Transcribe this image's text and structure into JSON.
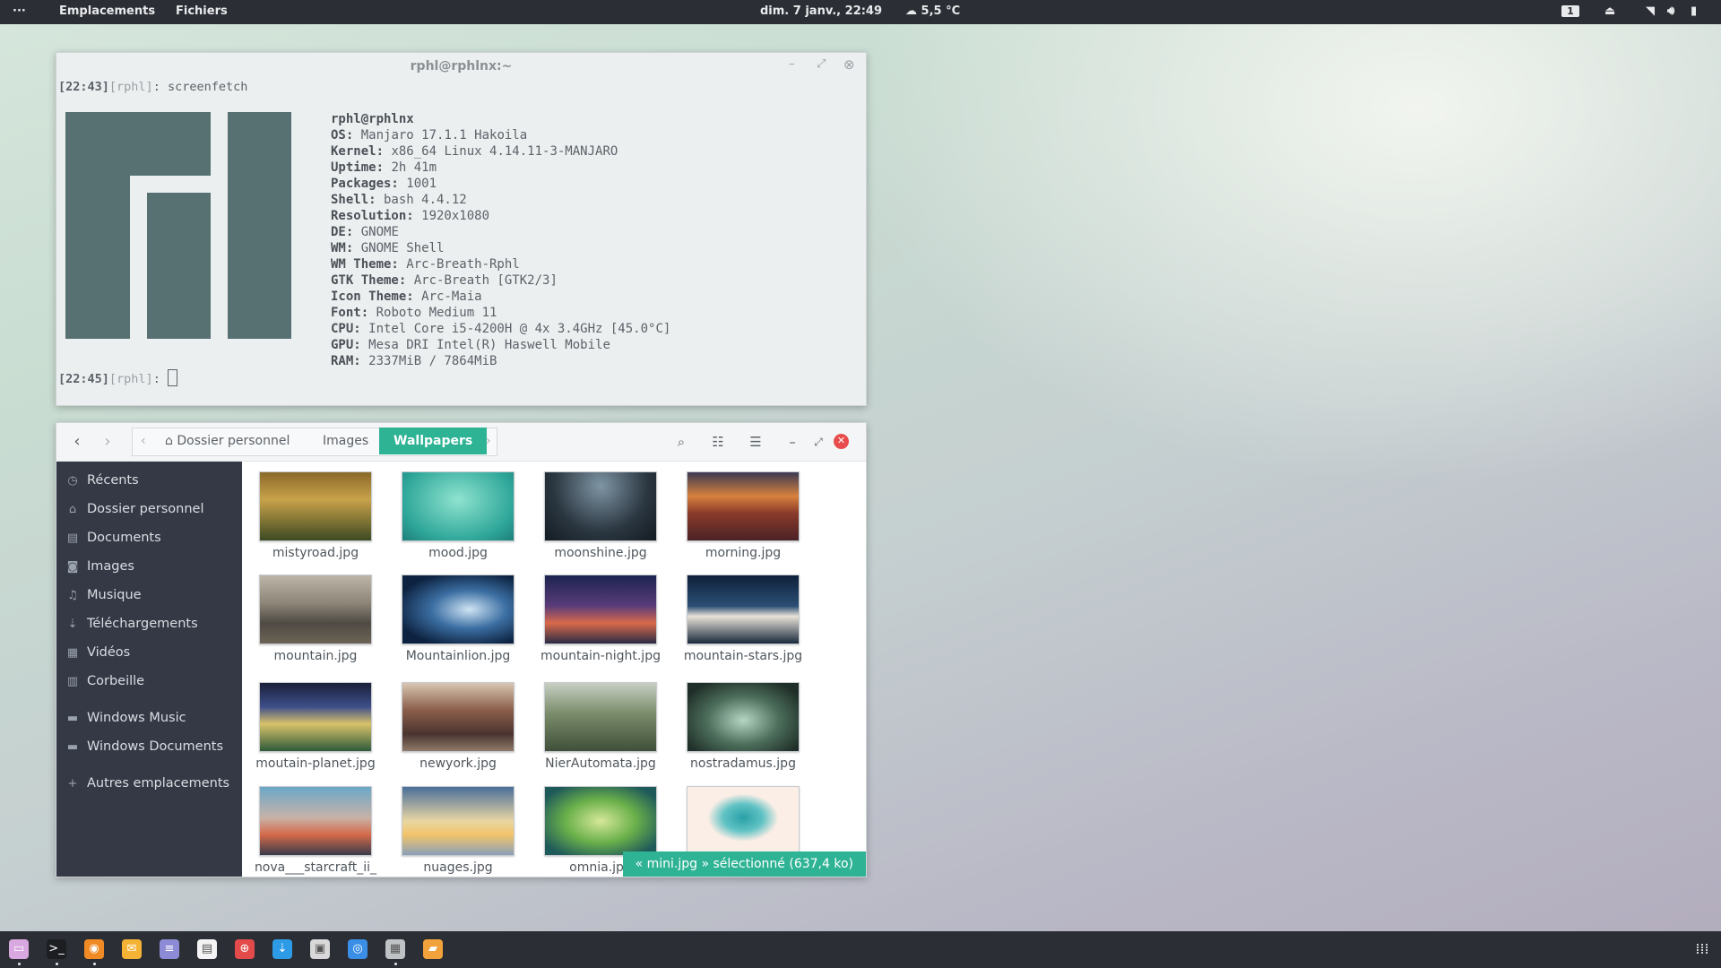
{
  "topbar": {
    "dots": "···",
    "places": "Emplacements",
    "files": "Fichiers",
    "datetime": "dim. 7 janv., 22:49",
    "weather": "☁ 5,5 °C",
    "workspace": "1"
  },
  "terminal": {
    "title": "rphl@rphlnx:~",
    "prompt1_time": "[22:43]",
    "prompt1_user": "[rphl]",
    "prompt1_cmd": ": screenfetch",
    "prompt2_time": "[22:45]",
    "prompt2_user": "[rphl]",
    "prompt2_rest": ": ",
    "user_host": "rphl@rphlnx",
    "info": [
      {
        "k": "OS:",
        "v": " Manjaro 17.1.1 Hakoila"
      },
      {
        "k": "Kernel:",
        "v": " x86_64 Linux 4.14.11-3-MANJARO"
      },
      {
        "k": "Uptime:",
        "v": " 2h 41m"
      },
      {
        "k": "Packages:",
        "v": " 1001"
      },
      {
        "k": "Shell:",
        "v": " bash 4.4.12"
      },
      {
        "k": "Resolution:",
        "v": " 1920x1080"
      },
      {
        "k": "DE:",
        "v": " GNOME"
      },
      {
        "k": "WM:",
        "v": " GNOME Shell"
      },
      {
        "k": "WM Theme:",
        "v": " Arc-Breath-Rphl"
      },
      {
        "k": "GTK Theme:",
        "v": " Arc-Breath [GTK2/3]"
      },
      {
        "k": "Icon Theme:",
        "v": " Arc-Maia"
      },
      {
        "k": "Font:",
        "v": " Roboto Medium 11"
      },
      {
        "k": "CPU:",
        "v": " Intel Core i5-4200H @ 4x 3.4GHz [45.0°C]"
      },
      {
        "k": "GPU:",
        "v": " Mesa DRI Intel(R) Haswell Mobile"
      },
      {
        "k": "RAM:",
        "v": " 2337MiB / 7864MiB"
      }
    ]
  },
  "files": {
    "crumbs": {
      "home": "Dossier personnel",
      "images": "Images",
      "wallpapers": "Wallpapers"
    },
    "sidebar": [
      {
        "icon": "clock-icon",
        "glyph": "◷",
        "label": "Récents"
      },
      {
        "icon": "home-icon",
        "glyph": "⌂",
        "label": "Dossier personnel"
      },
      {
        "icon": "document-icon",
        "glyph": "▤",
        "label": "Documents"
      },
      {
        "icon": "camera-icon",
        "glyph": "◙",
        "label": "Images"
      },
      {
        "icon": "music-icon",
        "glyph": "♫",
        "label": "Musique"
      },
      {
        "icon": "download-icon",
        "glyph": "⇣",
        "label": "Téléchargements"
      },
      {
        "icon": "film-icon",
        "glyph": "▦",
        "label": "Vidéos"
      },
      {
        "icon": "trash-icon",
        "glyph": "▥",
        "label": "Corbeille"
      },
      {
        "icon": "folder-icon",
        "glyph": "▬",
        "label": "Windows Music"
      },
      {
        "icon": "folder-icon",
        "glyph": "▬",
        "label": "Windows Documents"
      },
      {
        "icon": "plus-icon",
        "glyph": "+",
        "label": "Autres emplacements"
      }
    ],
    "items": [
      {
        "name": "mistyroad.jpg",
        "bg": "linear-gradient(180deg,#8a6a2a,#c9a24a 40%,#3c4a22)"
      },
      {
        "name": "mood.jpg",
        "bg": "radial-gradient(ellipse at 50% 40%,#8fe3cf,#2fa79a 70%,#1d7f7a)"
      },
      {
        "name": "moonshine.jpg",
        "bg": "radial-gradient(ellipse at 50% 20%,#7f95a4,#2a3640 60%,#141b22)"
      },
      {
        "name": "morning.jpg",
        "bg": "linear-gradient(180deg,#3b3a52,#d8813e 35%,#8a3a2a 60%,#4a2226)"
      },
      {
        "name": "mountain.jpg",
        "bg": "linear-gradient(180deg,#bdb5a8,#8e8679 40%,#4f4a44 70%,#6c6455)"
      },
      {
        "name": "Mountainlion.jpg",
        "bg": "radial-gradient(ellipse at 60% 50%,#cfe4f4,#3b6ea2 40%,#0d2240 80%)"
      },
      {
        "name": "mountain-night.jpg",
        "bg": "linear-gradient(180deg,#1c2350,#5a3c7a 45%,#d96a4a 70%,#2b2b44)"
      },
      {
        "name": "mountain-stars.jpg",
        "bg": "linear-gradient(180deg,#0e1f3a,#2b4f74 45%,#e8e2d8 60%,#1a2a3c)"
      },
      {
        "name": "moutain-planet.jpg",
        "bg": "linear-gradient(180deg,#1a1f3a,#3d4f8a 35%,#d9c26a 60%,#2f5a3a)"
      },
      {
        "name": "newyork.jpg",
        "bg": "linear-gradient(180deg,#d8c6b2,#8a5e4a 40%,#4a3430 75%,#8f7a6a)"
      },
      {
        "name": "NierAutomata.jpg",
        "bg": "linear-gradient(180deg,#c7cfc2,#7a8c6a 45%,#3f4f3a)"
      },
      {
        "name": "nostradamus.jpg",
        "bg": "radial-gradient(ellipse at 50% 55%,#b6d6c4,#4d6f5c 45%,#1f2e28 85%)"
      },
      {
        "name": "nova___starcraft_ii_",
        "bg": "linear-gradient(180deg,#6aa8c8,#c8b2a8 45%,#d46a4a 70%,#3a3a4a)"
      },
      {
        "name": "nuages.jpg",
        "bg": "linear-gradient(180deg,#4a6f9a,#e8d6a2 50%,#f2c46a 70%,#8aa0b8)"
      },
      {
        "name": "omnia.jpg",
        "bg": "radial-gradient(ellipse at 50% 50%,#d6e89a,#6ab04a 45%,#1f5a5a 85%)"
      },
      {
        "name": "mini.jpg",
        "bg": "radial-gradient(ellipse at 50% 45%,#2aa0a6,#5fc2c4 25%,#fbeee6 45%)"
      }
    ],
    "status": "« mini.jpg » sélectionné  (637,4 ko)"
  },
  "dock": {
    "apps": [
      {
        "name": "files-icon",
        "color": "#d9a8e0",
        "glyph": "▭"
      },
      {
        "name": "terminal-icon",
        "color": "#1c1e22",
        "glyph": ">_"
      },
      {
        "name": "firefox-icon",
        "color": "#f08a24",
        "glyph": "◉"
      },
      {
        "name": "mail-icon",
        "color": "#f5b335",
        "glyph": "✉"
      },
      {
        "name": "notes-icon",
        "color": "#8e8bd6",
        "glyph": "≡"
      },
      {
        "name": "text-editor-icon",
        "color": "#f4f4f4",
        "glyph": "▤"
      },
      {
        "name": "help-icon",
        "color": "#e34a4a",
        "glyph": "⊕"
      },
      {
        "name": "download-manager-icon",
        "color": "#2e9be6",
        "glyph": "⇣"
      },
      {
        "name": "screenshot-icon",
        "color": "#d8d8d8",
        "glyph": "▣"
      },
      {
        "name": "camera-app-icon",
        "color": "#3a8ee6",
        "glyph": "◎"
      },
      {
        "name": "calculator-icon",
        "color": "#bfc3c6",
        "glyph": "▦"
      },
      {
        "name": "image-viewer-icon",
        "color": "#f2a23a",
        "glyph": "▰"
      }
    ],
    "apps_grid_glyph": "⁞⁞⁞"
  }
}
